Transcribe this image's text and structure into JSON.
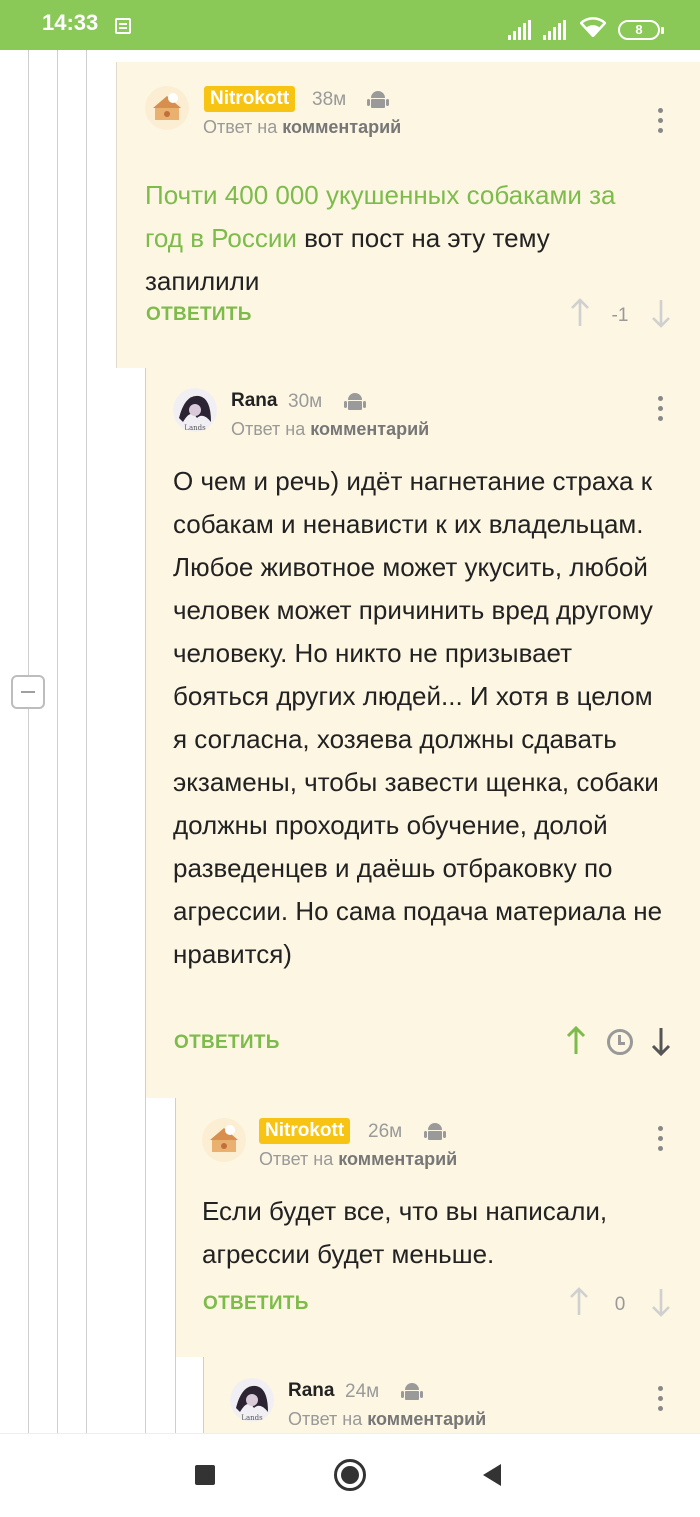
{
  "status_bar": {
    "time": "14:33",
    "battery": "8"
  },
  "colors": {
    "accent": "#7dbb4b",
    "status_bar": "#8ac858",
    "badge": "#f8c414",
    "comment_bg": "#fcf6e3"
  },
  "comments": [
    {
      "author": "Nitrokott",
      "author_style": "badge",
      "time_ago": "38м",
      "device_icon": "android-icon",
      "reply_prefix": "Ответ на",
      "reply_target": "комментарий",
      "text_link": "Почти 400 000 укушенных собаками за год в России",
      "text_rest": " вот пост на эту тему запилили",
      "reply_label": "ОТВЕТИТЬ",
      "score": "-1"
    },
    {
      "author": "Rana",
      "author_style": "plain",
      "time_ago": "30м",
      "device_icon": "android-icon",
      "reply_prefix": "Ответ на",
      "reply_target": "комментарий",
      "text": "О чем и речь) идёт нагнетание страха к собакам и ненависти к их владельцам. Любое животное может укусить, любой человек может причинить вред другому человеку. Но никто не призывает бояться других людей... И хотя в целом я согласна, хозяева должны сдавать экзамены, чтобы завести щенка, собаки должны проходить обучение, долой разведенцев и даёшь отбраковку по агрессии. Но сама подача материала не нравится)",
      "reply_label": "ОТВЕТИТЬ",
      "score_icon": "clock-icon"
    },
    {
      "author": "Nitrokott",
      "author_style": "badge",
      "time_ago": "26м",
      "device_icon": "android-icon",
      "reply_prefix": "Ответ на",
      "reply_target": "комментарий",
      "text": "Если будет все, что вы написали, агрессии будет меньше.",
      "reply_label": "ОТВЕТИТЬ",
      "score": "0"
    },
    {
      "author": "Rana",
      "author_style": "plain",
      "time_ago": "24м",
      "device_icon": "android-icon",
      "reply_prefix": "Ответ на",
      "reply_target": "комментарий"
    }
  ]
}
